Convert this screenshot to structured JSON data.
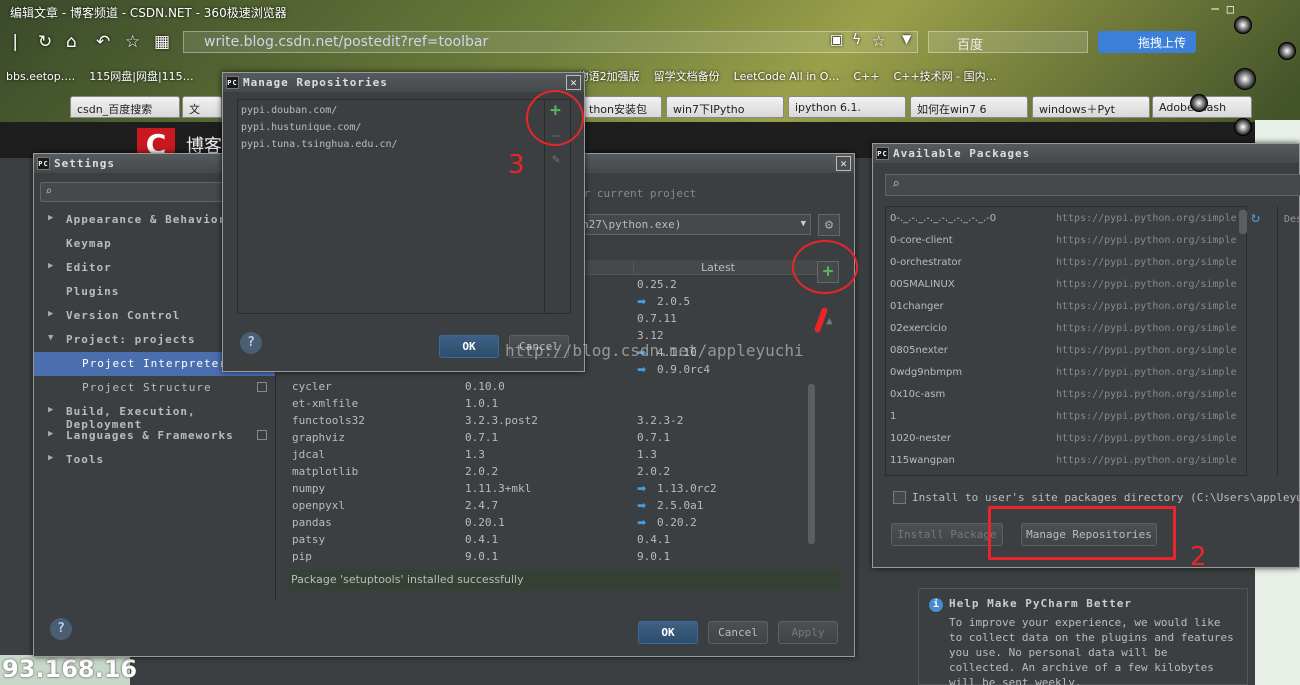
{
  "browser": {
    "window_title": "编辑文章 - 博客频道 - CSDN.NET - 360极速浏览器",
    "url": "write.blog.csdn.net/postedit?ref=toolbar",
    "search_placeholder": "百度",
    "cloud_button": "拖拽上传",
    "bookmarks": [
      "bbs.eetop.…",
      "115网盘|网盘|115…",
      "物语2加强版",
      "留学文档备份",
      "LeetCode All in O…",
      "C++",
      "C++技术网 - 国内…"
    ],
    "tabs": [
      "csdn_百度搜索",
      "文",
      "thon安装包",
      "win7下IPytho",
      "ipython 6.1.",
      "如何在win7 6",
      "windows＋Pyt",
      "Adobe Flash"
    ],
    "blog_title": "博客",
    "ip_fragment": "93.168.16"
  },
  "settings": {
    "title": "Settings",
    "tree": [
      {
        "label": "Appearance & Behavior",
        "arrow": "▶",
        "level": "top"
      },
      {
        "label": "Keymap",
        "arrow": "",
        "level": "top"
      },
      {
        "label": "Editor",
        "arrow": "▶",
        "level": "top"
      },
      {
        "label": "Plugins",
        "arrow": "",
        "level": "top"
      },
      {
        "label": "Version Control",
        "arrow": "▶",
        "level": "top"
      },
      {
        "label": "Project: projects",
        "arrow": "▼",
        "level": "top"
      },
      {
        "label": "Project Interpreter",
        "arrow": "",
        "level": "sub",
        "selected": true
      },
      {
        "label": "Project Structure",
        "arrow": "",
        "level": "sub"
      },
      {
        "label": "Build, Execution, Deployment",
        "arrow": "▶",
        "level": "top"
      },
      {
        "label": "Languages & Frameworks",
        "arrow": "▶",
        "level": "top"
      },
      {
        "label": "Tools",
        "arrow": "▶",
        "level": "top"
      }
    ],
    "subtitle_fragment": "or current project",
    "interpreter_fragment": "n27\\python.exe)",
    "column_latest": "Latest",
    "packages": [
      {
        "name": "",
        "version": "",
        "latest": "0.25.2",
        "update": false
      },
      {
        "name": "",
        "version": "",
        "latest": "2.0.5",
        "update": true
      },
      {
        "name": "",
        "version": "",
        "latest": "0.7.11",
        "update": false
      },
      {
        "name": "",
        "version": "",
        "latest": "3.12",
        "update": false
      },
      {
        "name": "",
        "version": "",
        "latest": "4.1.10",
        "update": true
      },
      {
        "name": "",
        "version": "",
        "latest": "0.9.0rc4",
        "update": true
      },
      {
        "name": "cycler",
        "version": "0.10.0",
        "latest": "",
        "update": false
      },
      {
        "name": "et-xmlfile",
        "version": "1.0.1",
        "latest": "",
        "update": false
      },
      {
        "name": "functools32",
        "version": "3.2.3.post2",
        "latest": "3.2.3-2",
        "update": false
      },
      {
        "name": "graphviz",
        "version": "0.7.1",
        "latest": "0.7.1",
        "update": false
      },
      {
        "name": "jdcal",
        "version": "1.3",
        "latest": "1.3",
        "update": false
      },
      {
        "name": "matplotlib",
        "version": "2.0.2",
        "latest": "2.0.2",
        "update": false
      },
      {
        "name": "numpy",
        "version": "1.11.3+mkl",
        "latest": "1.13.0rc2",
        "update": true
      },
      {
        "name": "openpyxl",
        "version": "2.4.7",
        "latest": "2.5.0a1",
        "update": true
      },
      {
        "name": "pandas",
        "version": "0.20.1",
        "latest": "0.20.2",
        "update": true
      },
      {
        "name": "patsy",
        "version": "0.4.1",
        "latest": "0.4.1",
        "update": false
      },
      {
        "name": "pip",
        "version": "9.0.1",
        "latest": "9.0.1",
        "update": false
      }
    ],
    "status": "Package 'setuptools' installed successfully",
    "ok": "OK",
    "cancel": "Cancel",
    "apply": "Apply"
  },
  "manage_repos": {
    "title": "Manage Repositories",
    "repos": [
      "pypi.douban.com/",
      "pypi.hustunique.com/",
      "pypi.tuna.tsinghua.edu.cn/"
    ],
    "ok": "OK",
    "cancel": "Cancel"
  },
  "available": {
    "title": "Available Packages",
    "packages": [
      {
        "name": "0-._.-._.-._.-._.-._.-._.-0",
        "url": "https://pypi.python.org/simple"
      },
      {
        "name": "0-core-client",
        "url": "https://pypi.python.org/simple"
      },
      {
        "name": "0-orchestrator",
        "url": "https://pypi.python.org/simple"
      },
      {
        "name": "00SMALINUX",
        "url": "https://pypi.python.org/simple"
      },
      {
        "name": "01changer",
        "url": "https://pypi.python.org/simple"
      },
      {
        "name": "02exercicio",
        "url": "https://pypi.python.org/simple"
      },
      {
        "name": "0805nexter",
        "url": "https://pypi.python.org/simple"
      },
      {
        "name": "0wdg9nbmpm",
        "url": "https://pypi.python.org/simple"
      },
      {
        "name": "0x10c-asm",
        "url": "https://pypi.python.org/simple"
      },
      {
        "name": "1",
        "url": "https://pypi.python.org/simple"
      },
      {
        "name": "1020-nester",
        "url": "https://pypi.python.org/simple"
      },
      {
        "name": "115wangpan",
        "url": "https://pypi.python.org/simple"
      }
    ],
    "desc_fragment": "Des",
    "install_to_user": "Install to user's site packages directory (C:\\Users\\appleyuchi\\Ap",
    "install_button": "Install Package",
    "manage_button": "Manage Repositories"
  },
  "annotations": {
    "num2": "2",
    "num3": "3",
    "watermark": "http://blog.csdn.net/appleyuchi"
  },
  "notification": {
    "title": "Help Make PyCharm Better",
    "body": "To improve your experience, we would like to collect data on the plugins and features you use. No personal data will be collected. An archive of a few kilobytes will be sent weekly."
  },
  "colors": {
    "accent": "#4b6eaf",
    "annotation": "#e8262a",
    "update_arrow": "#4a9ad8",
    "add_green": "#59b259"
  }
}
